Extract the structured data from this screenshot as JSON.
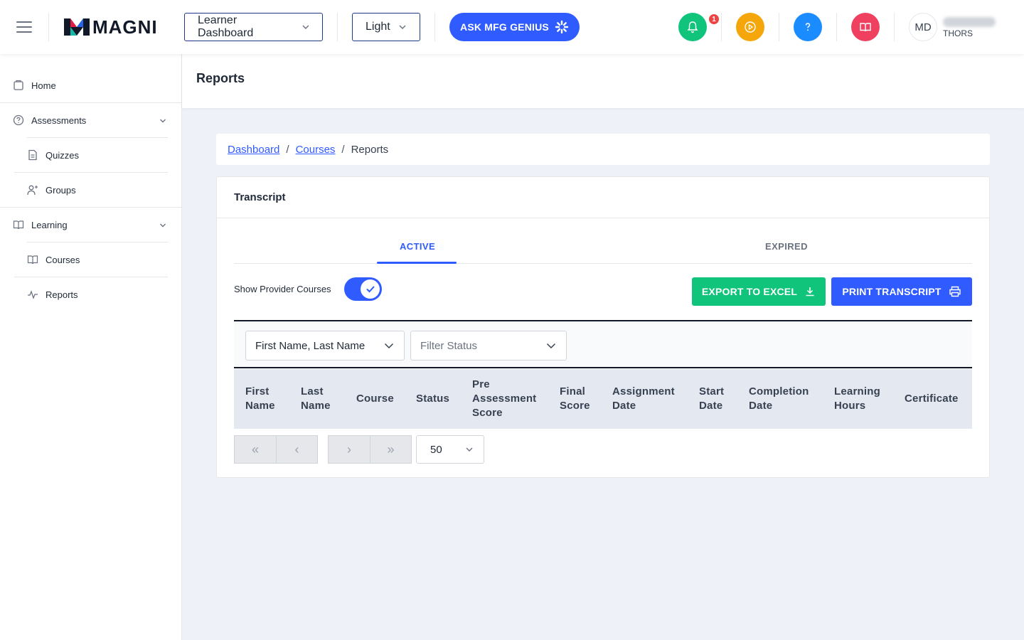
{
  "header": {
    "logo_text": "MAGNI",
    "dashboard_select": "Learner Dashboard",
    "theme_select": "Light",
    "ask_button": "ASK MFG GENIUS",
    "notification_count": "1",
    "avatar_initials": "MD",
    "user_org": "THORS",
    "colors": {
      "notify": "#10c47b",
      "play": "#f5a60a",
      "help": "#1a8cff",
      "book": "#f0405f",
      "brand": "#2f5bff"
    }
  },
  "sidebar": {
    "home": "Home",
    "assessments": "Assessments",
    "quizzes": "Quizzes",
    "groups": "Groups",
    "learning": "Learning",
    "courses": "Courses",
    "reports": "Reports"
  },
  "page": {
    "title": "Reports"
  },
  "breadcrumb": {
    "dashboard": "Dashboard",
    "courses": "Courses",
    "current": "Reports",
    "sep": "/"
  },
  "transcript": {
    "title": "Transcript",
    "tabs": {
      "active": "ACTIVE",
      "expired": "EXPIRED"
    },
    "toggle_label": "Show Provider Courses",
    "toggle_on": true,
    "export_button": "EXPORT TO EXCEL",
    "print_button": "PRINT TRANSCRIPT",
    "filters": {
      "name_select": "First Name, Last Name",
      "status_placeholder": "Filter Status"
    },
    "columns": {
      "first_name": [
        "First",
        "Name"
      ],
      "last_name": [
        "Last",
        "Name"
      ],
      "course": [
        "Course"
      ],
      "status": [
        "Status"
      ],
      "pre_assessment": [
        "Pre",
        "Assessment",
        "Score"
      ],
      "final_score": [
        "Final",
        "Score"
      ],
      "assignment_date": [
        "Assignment",
        "Date"
      ],
      "start_date": [
        "Start",
        "Date"
      ],
      "completion_date": [
        "Completion",
        "Date"
      ],
      "learning_hours": [
        "Learning",
        "Hours"
      ],
      "certificate": [
        "Certificate"
      ]
    },
    "pagination": {
      "first": "«",
      "prev": "‹",
      "next": "›",
      "last": "»",
      "per_page": "50"
    }
  }
}
